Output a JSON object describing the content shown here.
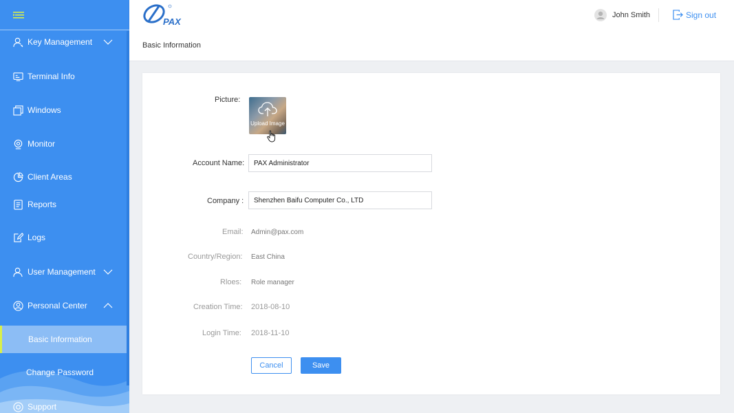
{
  "brand": {
    "logo_text": "PAX"
  },
  "header": {
    "user_name": "John Smith",
    "signout_label": "Sign out"
  },
  "breadcrumb": {
    "title": "Basic Information"
  },
  "sidebar": {
    "items": [
      {
        "label": "Key Management",
        "icon": "key-icon"
      },
      {
        "label": "Terminal Info",
        "icon": "terminal-icon"
      },
      {
        "label": "Windows",
        "icon": "windows-icon"
      },
      {
        "label": "Monitor",
        "icon": "monitor-icon"
      },
      {
        "label": "Client Areas",
        "icon": "pie-chart-icon"
      },
      {
        "label": "Reports",
        "icon": "document-icon"
      },
      {
        "label": "Logs",
        "icon": "edit-icon"
      },
      {
        "label": "User Management",
        "icon": "user-icon"
      },
      {
        "label": "Personal Center",
        "icon": "user-circle-icon"
      }
    ],
    "sub_items": [
      {
        "label": "Basic Information",
        "active": true
      },
      {
        "label": "Change Password",
        "active": false
      }
    ],
    "support_label": "Support"
  },
  "form": {
    "picture_label": "Picture:",
    "upload_label": "Upload Image",
    "account_name_label": "Account Name:",
    "account_name_value": "PAX Administrator",
    "company_label": "Company :",
    "company_value": "Shenzhen Baifu Computer Co., LTD",
    "email_label": "Email:",
    "email_value": "Admin@pax.com",
    "country_label": "Country/Region:",
    "country_value": "East China",
    "roles_label": "Rloes:",
    "roles_value": "Role manager",
    "creation_label": "Creation Time:",
    "creation_value": "2018-08-10",
    "login_label": "Login Time:",
    "login_value": "2018-11-10",
    "cancel_label": "Cancel",
    "save_label": "Save"
  },
  "colors": {
    "accent": "#3d8ff0",
    "sidebar_bg": "#3d8ff0",
    "active_sub_bg": "#8cbdf5",
    "active_marker": "#d9ef4a"
  }
}
